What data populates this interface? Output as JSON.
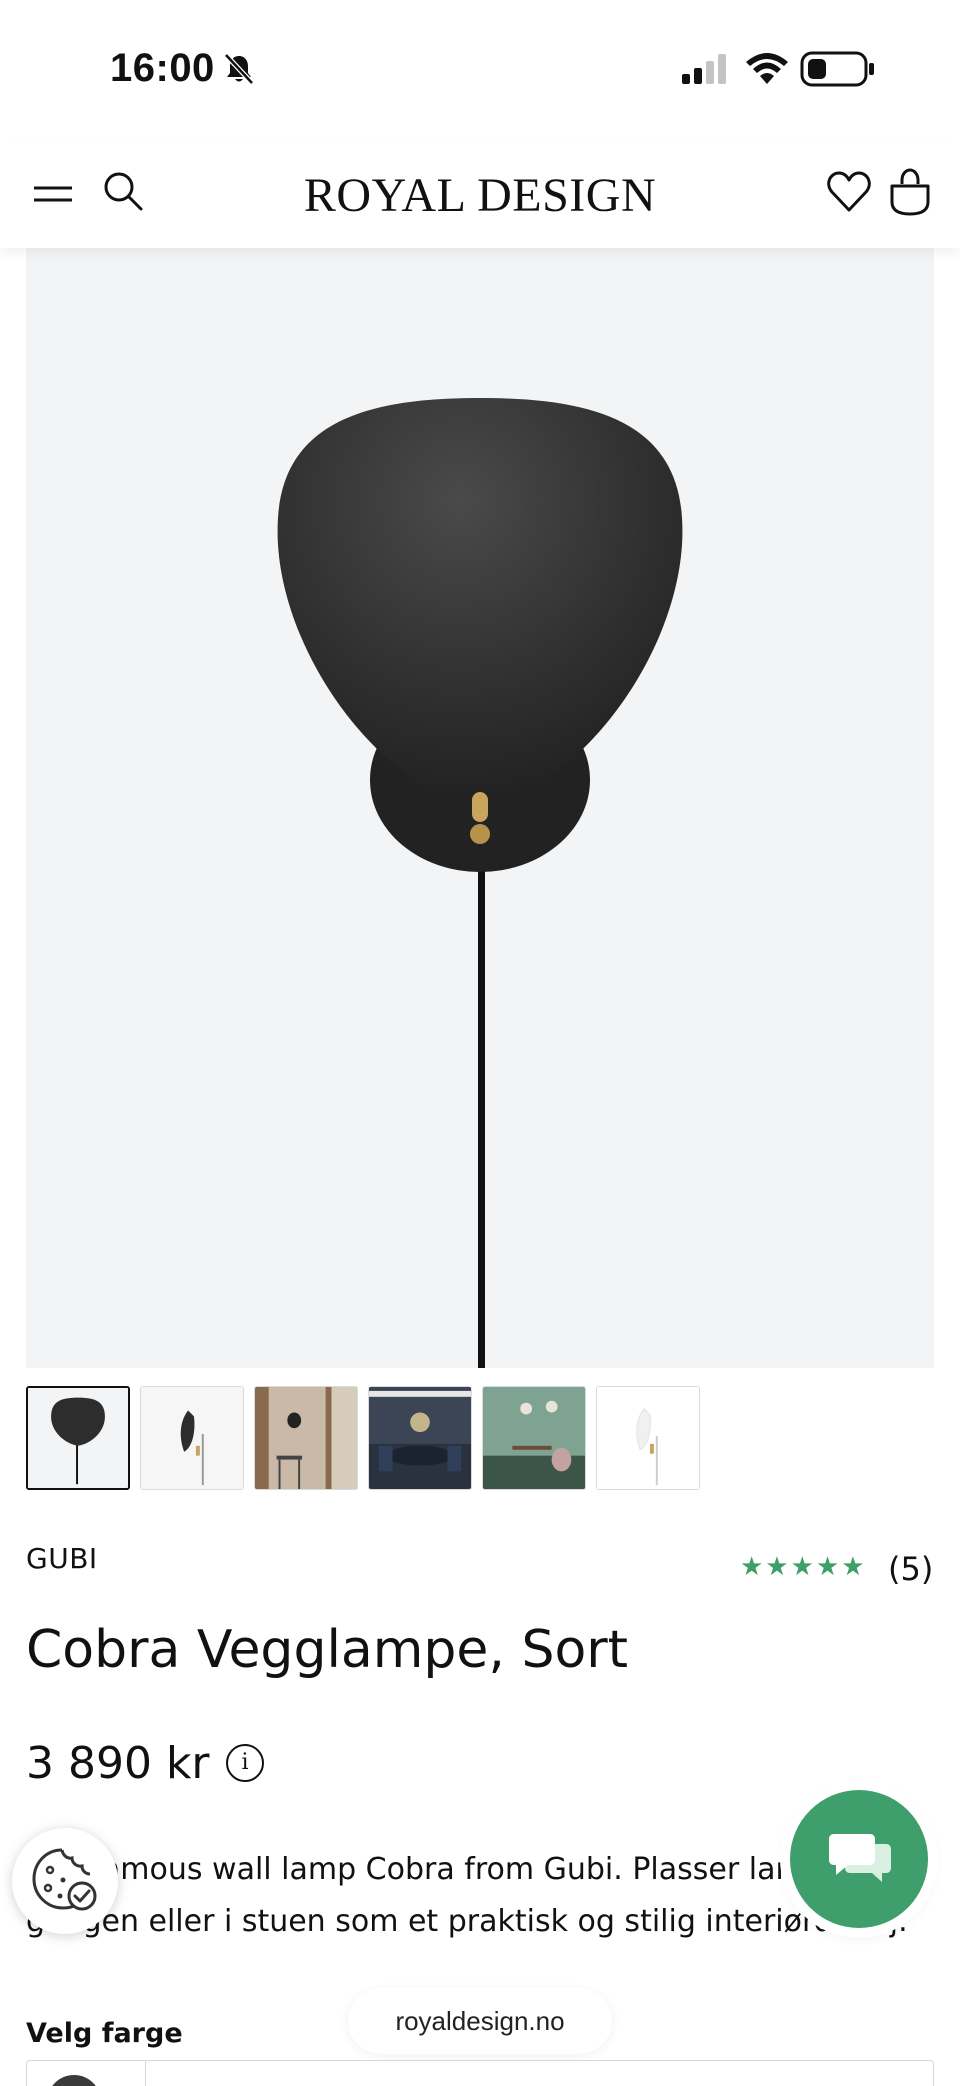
{
  "status_bar": {
    "time": "16:00"
  },
  "header": {
    "logo": "ROYAL DESIGN"
  },
  "product": {
    "brand": "GUBI",
    "rating_stars": "★★★★★",
    "rating_value": 5,
    "review_count": "(5)",
    "title": "Cobra Vegglampe, Sort",
    "price": "3 890 kr",
    "info_icon_glyph": "i",
    "description_line1": "The famous wall lamp Cobra from Gubi. Plasser lampen i",
    "description_line2": "gangen eller i stuen som et praktisk og stilig interiørdetalj.",
    "color_label": "Velg farge"
  },
  "thumbnails": [
    {
      "name": "thumb-front"
    },
    {
      "name": "thumb-side"
    },
    {
      "name": "thumb-room-hall"
    },
    {
      "name": "thumb-room-dining"
    },
    {
      "name": "thumb-room-green"
    },
    {
      "name": "thumb-white"
    }
  ],
  "browser": {
    "domain": "royaldesign.no"
  },
  "colors": {
    "accent_green": "#3e9f6d",
    "star_green": "#3f9f69",
    "image_bg": "#f3f4f5",
    "text": "#111111"
  },
  "icons": [
    "bell-slash-icon",
    "signal-icon",
    "wifi-icon",
    "battery-icon",
    "menu-icon",
    "search-icon",
    "heart-icon",
    "bag-icon",
    "info-icon",
    "cookie-icon",
    "chat-icon"
  ]
}
